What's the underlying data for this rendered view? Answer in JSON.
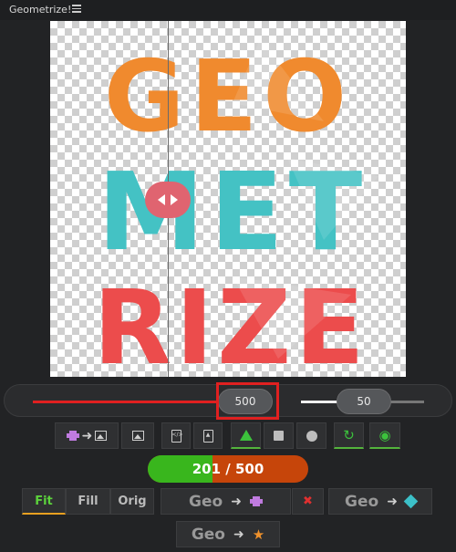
{
  "app": {
    "title": "Geometrize!",
    "menu_icon": "hamburger-icon"
  },
  "artwork": {
    "rows": [
      {
        "text": "GEO",
        "color": "#f08a2e"
      },
      {
        "text": "MET",
        "color": "#44c2c4"
      },
      {
        "text": "RIZE",
        "color": "#ec4c4c"
      }
    ]
  },
  "sliders": {
    "shapes": {
      "value": "500"
    },
    "alpha": {
      "value": "50"
    }
  },
  "toolbar": {
    "buttons": [
      {
        "name": "save-video-button",
        "icons": [
          "film-icon",
          "arrow-right-icon",
          "image-icon"
        ]
      },
      {
        "name": "open-image-button",
        "icons": [
          "image-icon"
        ]
      },
      {
        "name": "export-svg-button",
        "icons": [
          "document-icon"
        ]
      },
      {
        "name": "save-image-button",
        "icons": [
          "image-file-icon"
        ]
      },
      {
        "name": "triangle-shape-toggle",
        "icons": [
          "triangle-icon"
        ],
        "active": true
      },
      {
        "name": "rectangle-shape-toggle",
        "icons": [
          "square-icon"
        ]
      },
      {
        "name": "circle-shape-toggle",
        "icons": [
          "circle-icon"
        ]
      },
      {
        "name": "reset-button",
        "icons": [
          "refresh-icon"
        ],
        "color": "#3cc23c"
      },
      {
        "name": "run-toggle-button",
        "icons": [
          "target-icon"
        ],
        "color": "#3cc23c"
      }
    ]
  },
  "progress": {
    "current": 201,
    "total": 500,
    "label": "201 / 500",
    "fill_color": "#39b61d",
    "remaining_color": "#c6450a"
  },
  "view_tabs": {
    "fit": "Fit",
    "fill": "Fill",
    "orig": "Orig",
    "active": "fit"
  },
  "export": {
    "geo_label": "Geo",
    "to_video": {
      "target_icon": "film-icon"
    },
    "to_shape": {
      "target_icon": "diamond-icon",
      "color": "#3cc0c8"
    },
    "to_star": {
      "target_icon": "star-icon",
      "color": "#f0922c"
    },
    "cancel_icon": "x-icon"
  },
  "accent_colors": {
    "highlight": "#e02020",
    "green": "#54b43c",
    "tab_underline": "#e8a020"
  }
}
